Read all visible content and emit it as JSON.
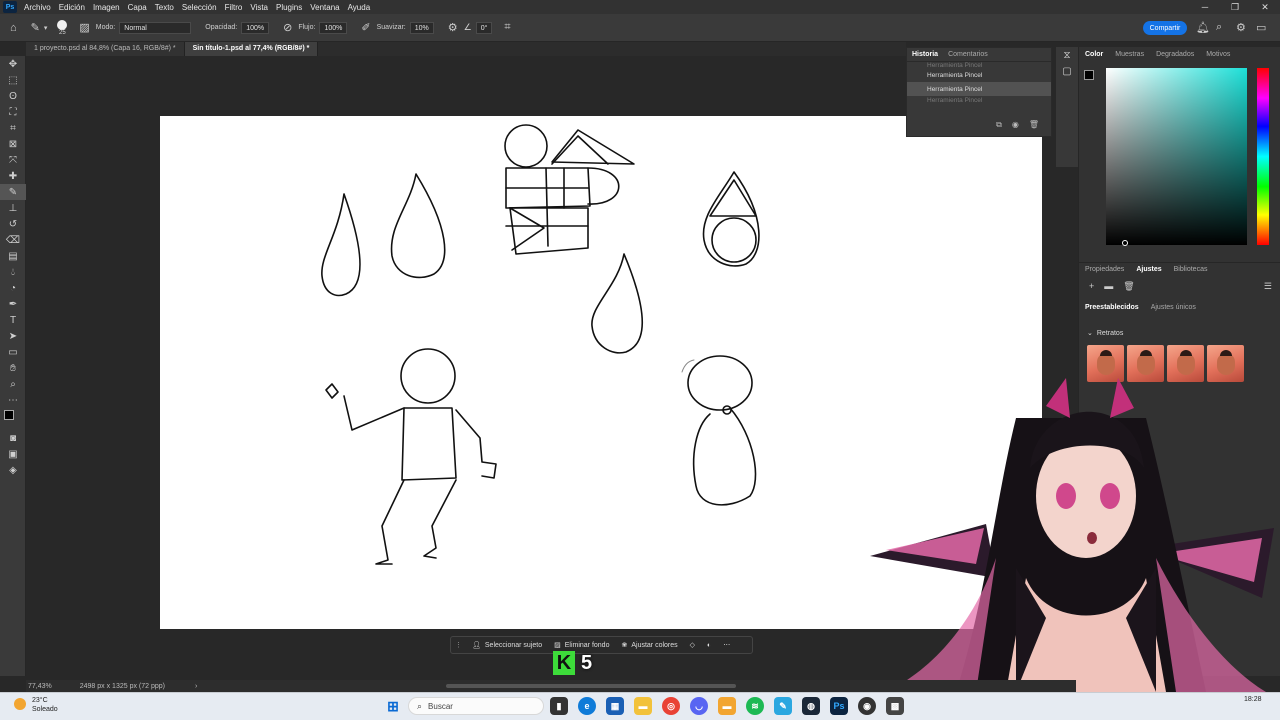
{
  "menubar": {
    "logo": "Ps",
    "items": [
      "Archivo",
      "Edición",
      "Imagen",
      "Capa",
      "Texto",
      "Selección",
      "Filtro",
      "Vista",
      "Plugins",
      "Ventana",
      "Ayuda"
    ]
  },
  "options": {
    "brush_size": "25",
    "mode_label": "Modo:",
    "mode_value": "Normal",
    "opacity_label": "Opacidad:",
    "opacity_value": "100%",
    "flow_label": "Flujo:",
    "flow_value": "100%",
    "smooth_label": "Suavizar:",
    "smooth_value": "10%",
    "angle_value": "0°",
    "share_label": "Compartir"
  },
  "tabs": [
    {
      "label": "1 proyecto.psd al 84,8% (Capa 16, RGB/8#) *"
    },
    {
      "label": "Sin título-1.psd al 77,4% (RGB/8#) *"
    }
  ],
  "history": {
    "tabs": [
      "Historia",
      "Comentarios"
    ],
    "items": [
      "Herramienta Pincel",
      "Herramienta Pincel",
      "Herramienta Pincel",
      "Herramienta Pincel"
    ]
  },
  "color_panel": {
    "tabs": [
      "Color",
      "Muestras",
      "Degradados",
      "Motivos"
    ],
    "accent": "#1de0d8"
  },
  "adjust_panel": {
    "tabs": [
      "Propiedades",
      "Ajustes",
      "Bibliotecas"
    ],
    "subtabs": [
      "Preestablecidos",
      "Ajustes únicos"
    ],
    "section": "Retratos"
  },
  "contextbar": {
    "select_subject": "Seleccionar sujeto",
    "remove_bg": "Eliminar fondo",
    "adjust_colors": "Ajustar colores"
  },
  "overlay": {
    "k": "K",
    "num": "5"
  },
  "status": {
    "zoom": "77,43%",
    "doc_info": "2498 px x 1325 px (72 ppp)"
  },
  "taskbar": {
    "temp": "23°C",
    "weather": "Soleado",
    "search_placeholder": "Buscar",
    "time": "18:28"
  }
}
